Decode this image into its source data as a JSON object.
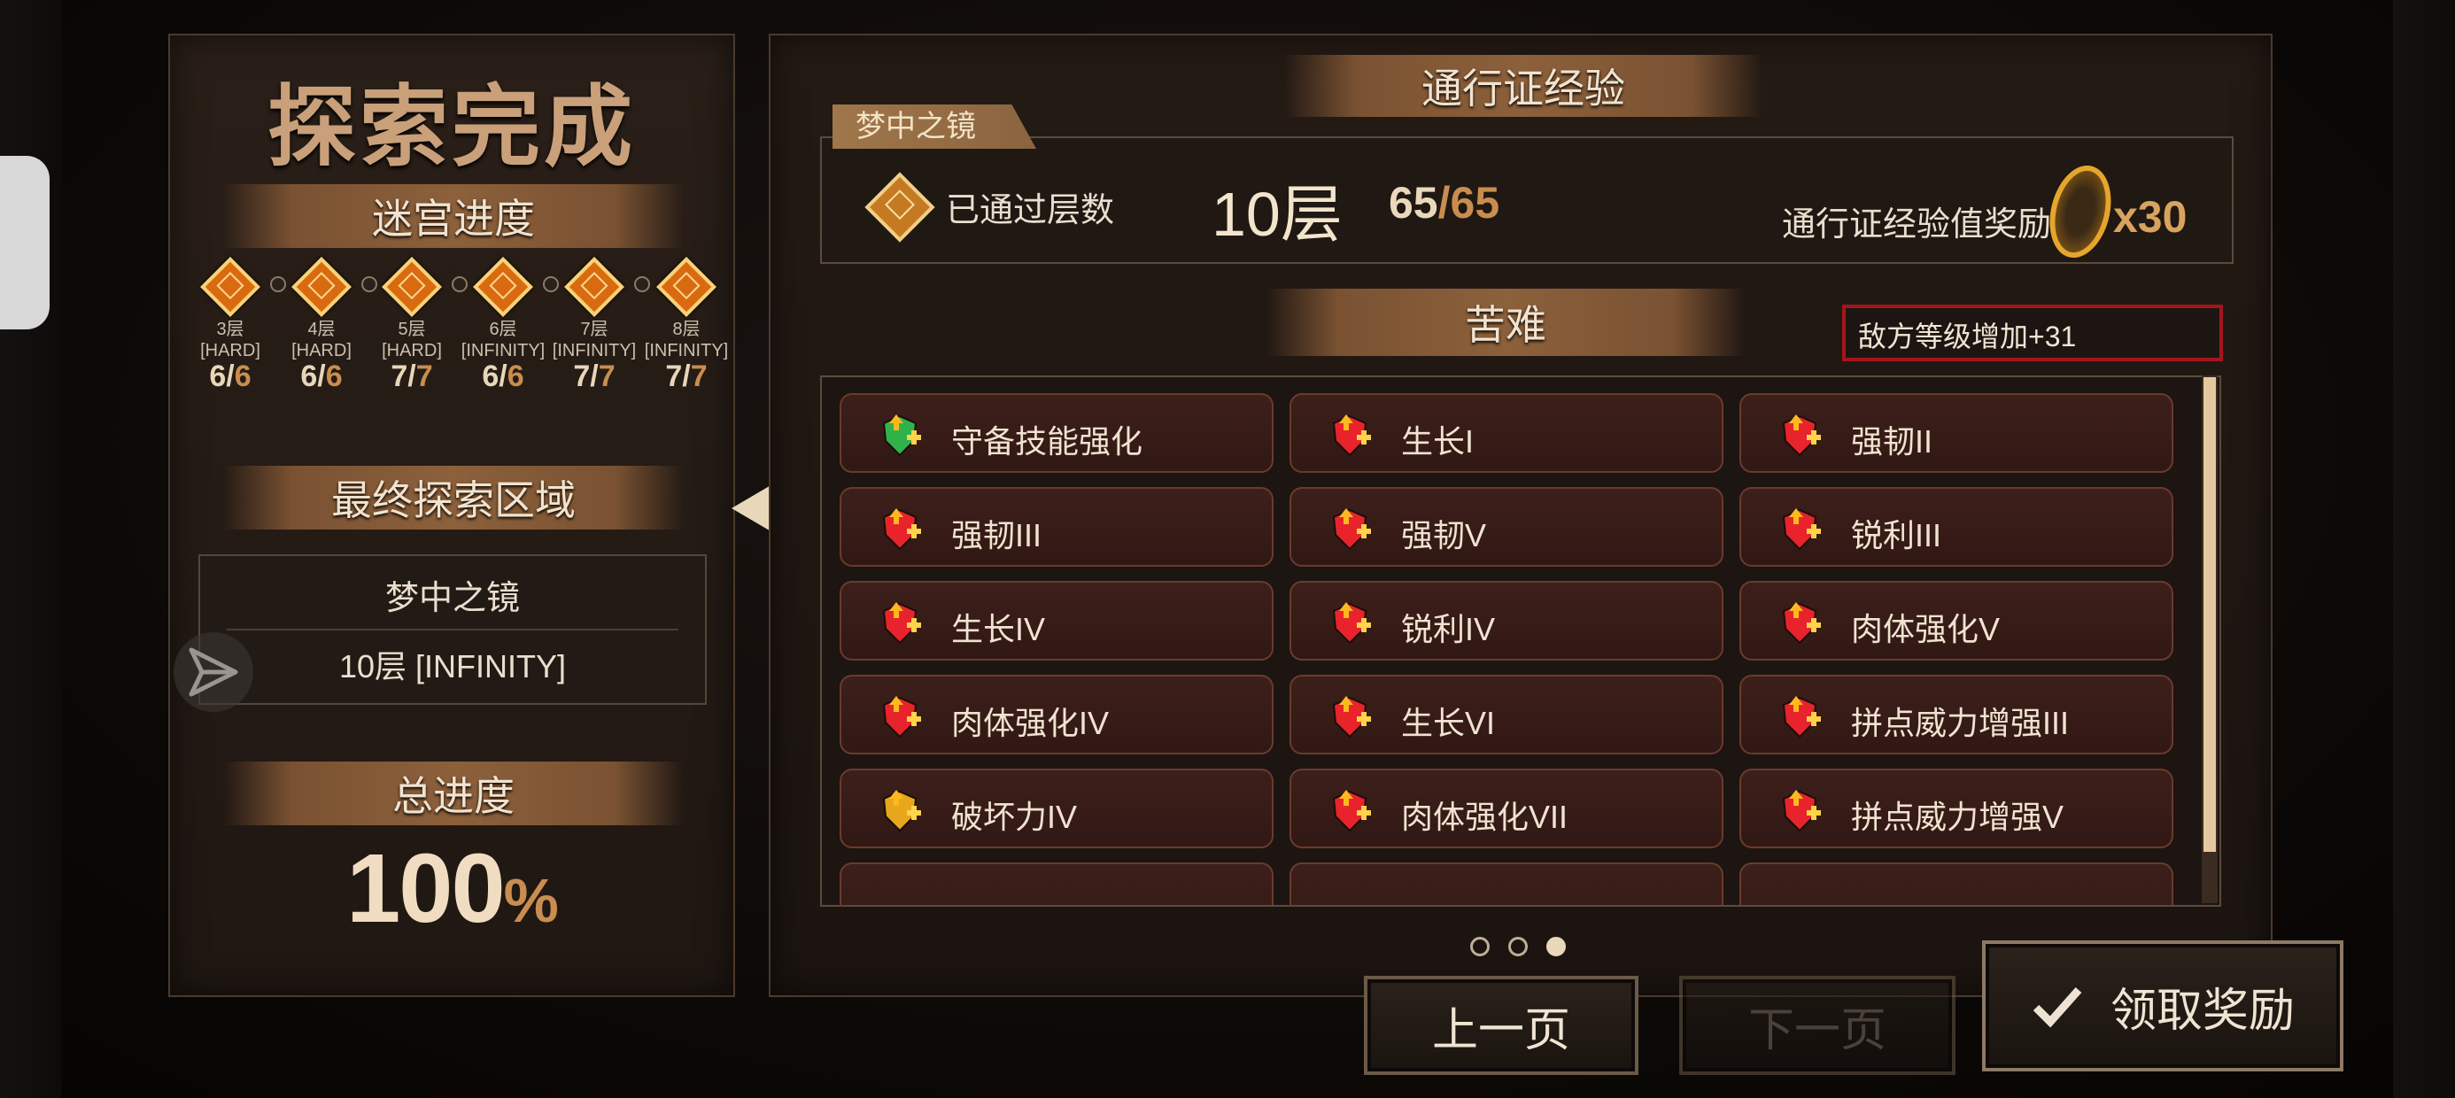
{
  "left": {
    "title": "探索完成",
    "maze_header": "迷宫进度",
    "levels": [
      {
        "floor": "3层",
        "diff": "[HARD]",
        "done": "6",
        "total": "6"
      },
      {
        "floor": "4层",
        "diff": "[HARD]",
        "done": "6",
        "total": "6"
      },
      {
        "floor": "5层",
        "diff": "[HARD]",
        "done": "7",
        "total": "7"
      },
      {
        "floor": "6层",
        "diff": "[INFINITY]",
        "done": "6",
        "total": "6"
      },
      {
        "floor": "7层",
        "diff": "[INFINITY]",
        "done": "7",
        "total": "7"
      },
      {
        "floor": "8层",
        "diff": "[INFINITY]",
        "done": "7",
        "total": "7"
      }
    ],
    "final_zone_header": "最终探索区域",
    "final_zone_name": "梦中之镜",
    "final_zone_level": "10层 [INFINITY]",
    "total_header": "总进度",
    "total_value": "100",
    "total_unit": "%"
  },
  "right": {
    "header": "通行证经验",
    "tab": "梦中之镜",
    "passed_label": "已通过层数",
    "passed_value": "10层",
    "passed_count": "65",
    "passed_total": "/65",
    "reward_label": "通行证经验值奖励",
    "reward_mult": "x30",
    "hardship_header": "苦难",
    "enemy_level": "敌方等级增加+31",
    "cards": [
      {
        "label": "守备技能强化",
        "icon": "green-shield-plus-icon",
        "color": "#2fb24a"
      },
      {
        "label": "生长I",
        "icon": "heart-up-arrow-icon",
        "color": "#e8232b"
      },
      {
        "label": "强韧II",
        "icon": "shield-heart-plus-icon",
        "color": "#e8232b"
      },
      {
        "label": "强韧III",
        "icon": "heart-plus-shield-icon",
        "color": "#e8232b"
      },
      {
        "label": "强韧V",
        "icon": "plus-up-arrow-icon",
        "color": "#e8232b"
      },
      {
        "label": "锐利III",
        "icon": "arrows-heart-icon",
        "color": "#e8232b"
      },
      {
        "label": "生长IV",
        "icon": "heart-up-arrow-icon",
        "color": "#e8232b"
      },
      {
        "label": "锐利IV",
        "icon": "arrows-plus-icon",
        "color": "#e8232b"
      },
      {
        "label": "肉体强化V",
        "icon": "crossed-swords-up-icon",
        "color": "#e8232b"
      },
      {
        "label": "肉体强化IV",
        "icon": "crossed-swords-up-icon",
        "color": "#e8232b"
      },
      {
        "label": "生长VI",
        "icon": "heart-up-arrow-icon",
        "color": "#e8232b"
      },
      {
        "label": "拼点威力增强III",
        "icon": "crossed-swords-up-icon",
        "color": "#e8232b"
      },
      {
        "label": "破坏力IV",
        "icon": "gear-up-icon",
        "color": "#e8a61c"
      },
      {
        "label": "肉体强化VII",
        "icon": "crossed-swords-up-icon",
        "color": "#e8232b"
      },
      {
        "label": "拼点威力增强V",
        "icon": "crossed-swords-up-icon",
        "color": "#e8232b"
      }
    ],
    "pagination": {
      "current": 3,
      "total": 3
    },
    "prev_label": "上一页",
    "next_label": "下一页",
    "claim_label": "领取奖励"
  }
}
